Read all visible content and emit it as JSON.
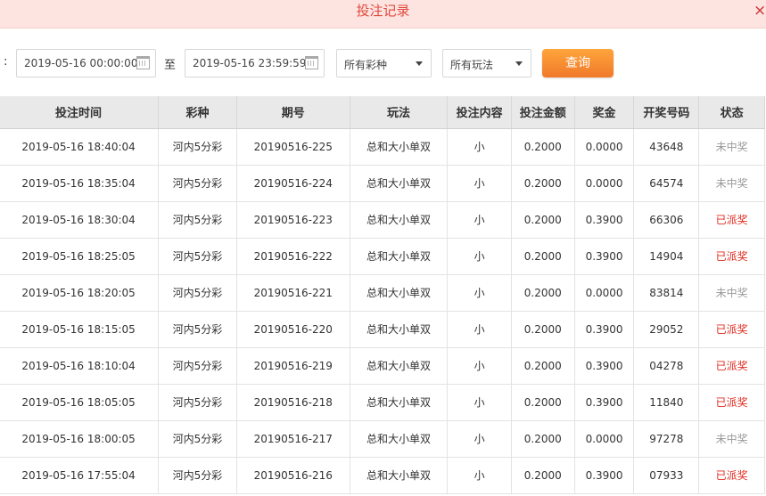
{
  "header": {
    "title": "投注记录",
    "close_glyph": "×"
  },
  "filters": {
    "colon": ":",
    "start_date": "2019-05-16 00:00:00",
    "to_label": "至",
    "end_date": "2019-05-16 23:59:59",
    "lottery_select": "所有彩种",
    "play_select": "所有玩法",
    "query_button": "查询"
  },
  "table": {
    "columns": [
      "投注时间",
      "彩种",
      "期号",
      "玩法",
      "投注内容",
      "投注金额",
      "奖金",
      "开奖号码",
      "状态"
    ],
    "rows": [
      {
        "time": "2019-05-16 18:40:04",
        "lottery": "河内5分彩",
        "issue": "20190516-225",
        "play": "总和大小单双",
        "content": "小",
        "amount": "0.2000",
        "prize": "0.0000",
        "number": "43648",
        "status": "未中奖",
        "won": false
      },
      {
        "time": "2019-05-16 18:35:04",
        "lottery": "河内5分彩",
        "issue": "20190516-224",
        "play": "总和大小单双",
        "content": "小",
        "amount": "0.2000",
        "prize": "0.0000",
        "number": "64574",
        "status": "未中奖",
        "won": false
      },
      {
        "time": "2019-05-16 18:30:04",
        "lottery": "河内5分彩",
        "issue": "20190516-223",
        "play": "总和大小单双",
        "content": "小",
        "amount": "0.2000",
        "prize": "0.3900",
        "number": "66306",
        "status": "已派奖",
        "won": true
      },
      {
        "time": "2019-05-16 18:25:05",
        "lottery": "河内5分彩",
        "issue": "20190516-222",
        "play": "总和大小单双",
        "content": "小",
        "amount": "0.2000",
        "prize": "0.3900",
        "number": "14904",
        "status": "已派奖",
        "won": true
      },
      {
        "time": "2019-05-16 18:20:05",
        "lottery": "河内5分彩",
        "issue": "20190516-221",
        "play": "总和大小单双",
        "content": "小",
        "amount": "0.2000",
        "prize": "0.0000",
        "number": "83814",
        "status": "未中奖",
        "won": false
      },
      {
        "time": "2019-05-16 18:15:05",
        "lottery": "河内5分彩",
        "issue": "20190516-220",
        "play": "总和大小单双",
        "content": "小",
        "amount": "0.2000",
        "prize": "0.3900",
        "number": "29052",
        "status": "已派奖",
        "won": true
      },
      {
        "time": "2019-05-16 18:10:04",
        "lottery": "河内5分彩",
        "issue": "20190516-219",
        "play": "总和大小单双",
        "content": "小",
        "amount": "0.2000",
        "prize": "0.3900",
        "number": "04278",
        "status": "已派奖",
        "won": true
      },
      {
        "time": "2019-05-16 18:05:05",
        "lottery": "河内5分彩",
        "issue": "20190516-218",
        "play": "总和大小单双",
        "content": "小",
        "amount": "0.2000",
        "prize": "0.3900",
        "number": "11840",
        "status": "已派奖",
        "won": true
      },
      {
        "time": "2019-05-16 18:00:05",
        "lottery": "河内5分彩",
        "issue": "20190516-217",
        "play": "总和大小单双",
        "content": "小",
        "amount": "0.2000",
        "prize": "0.0000",
        "number": "97278",
        "status": "未中奖",
        "won": false
      },
      {
        "time": "2019-05-16 17:55:04",
        "lottery": "河内5分彩",
        "issue": "20190516-216",
        "play": "总和大小单双",
        "content": "小",
        "amount": "0.2000",
        "prize": "0.3900",
        "number": "07933",
        "status": "已派奖",
        "won": true
      }
    ]
  },
  "colors": {
    "title": "#e0483b",
    "header_bg": "#fde4e1",
    "won": "#e02b20",
    "lost": "#999999",
    "button": "#f0792a"
  },
  "icons": {
    "close": "close-icon",
    "calendar": "calendar-icon",
    "dropdown": "chevron-down-icon"
  }
}
